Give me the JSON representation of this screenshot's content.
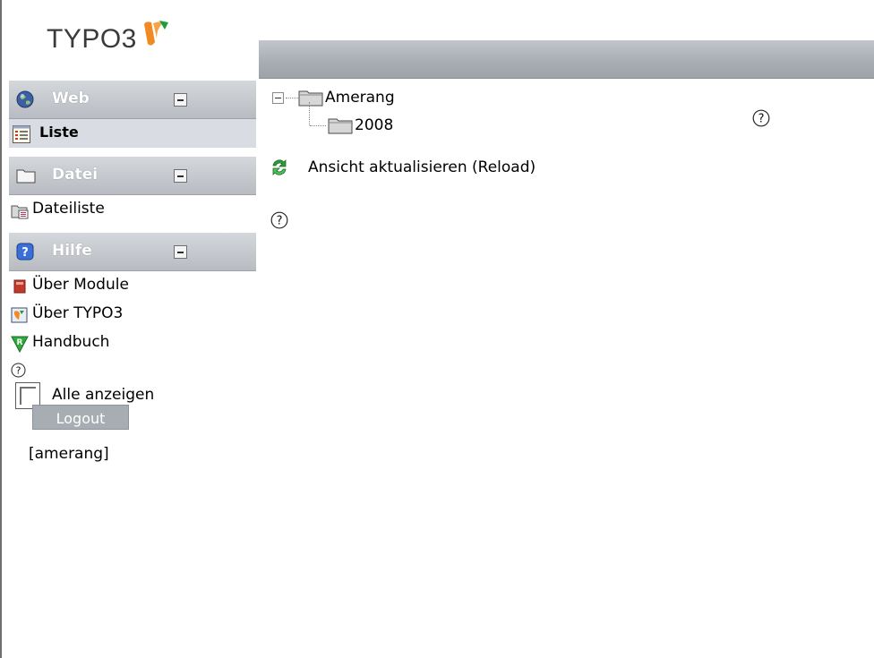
{
  "logo": {
    "text": "TYPO3"
  },
  "sidebar": {
    "groups": [
      {
        "label": "Web",
        "icon": "globe-icon",
        "items": [
          {
            "label": "Liste",
            "icon": "list-icon",
            "active": true
          }
        ]
      },
      {
        "label": "Datei",
        "icon": "folder-icon",
        "items": [
          {
            "label": "Dateiliste",
            "icon": "filelist-icon"
          }
        ]
      },
      {
        "label": "Hilfe",
        "icon": "help-icon",
        "items": [
          {
            "label": "Über Module",
            "icon": "book-icon"
          },
          {
            "label": "Über TYPO3",
            "icon": "typo3-icon"
          },
          {
            "label": "Handbuch",
            "icon": "manual-icon"
          }
        ]
      }
    ],
    "show_all_label": "Alle anzeigen",
    "logout_label": "Logout",
    "username": "[amerang]"
  },
  "main": {
    "tree": {
      "root": "Amerang",
      "child": "2008"
    },
    "reload_label": "Ansicht aktualisieren (Reload)"
  },
  "colors": {
    "header_bar": "#a9adb4",
    "group_header": "#c4c8cd",
    "active_item": "#d9dce2",
    "logo_orange": "#f08a24",
    "logo_green": "#1e9e3a"
  }
}
